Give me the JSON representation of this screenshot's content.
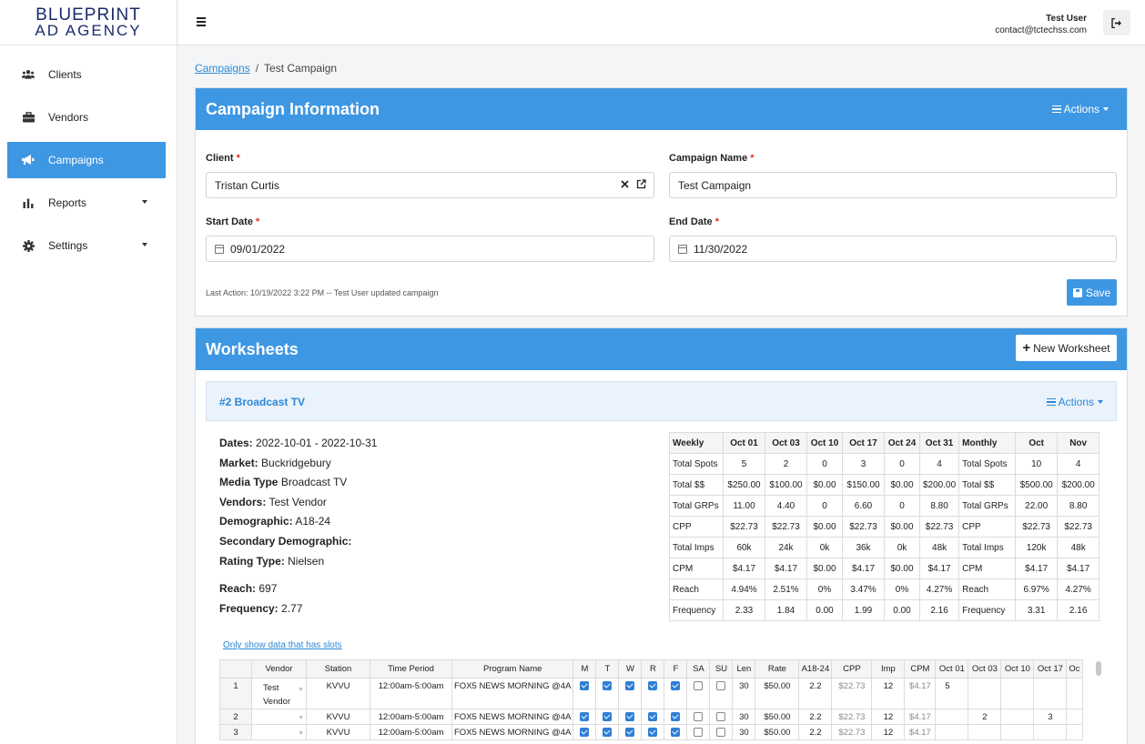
{
  "logo": {
    "line1": "BLUEPRINT",
    "line2": "AD AGENCY"
  },
  "sidebar": {
    "items": [
      {
        "label": "Clients",
        "icon": "users-icon"
      },
      {
        "label": "Vendors",
        "icon": "briefcase-icon"
      },
      {
        "label": "Campaigns",
        "icon": "megaphone-icon",
        "active": true
      },
      {
        "label": "Reports",
        "icon": "bar-chart-icon",
        "has_submenu": true
      },
      {
        "label": "Settings",
        "icon": "gear-icon",
        "has_submenu": true
      }
    ]
  },
  "topbar": {
    "user_name": "Test User",
    "user_email": "contact@tctechss.com"
  },
  "breadcrumb": {
    "parent": "Campaigns",
    "separator": "/",
    "current": "Test Campaign"
  },
  "campaign_info": {
    "title": "Campaign Information",
    "actions_label": "Actions",
    "client_label": "Client",
    "client_value": "Tristan Curtis",
    "campaign_name_label": "Campaign Name",
    "campaign_name_value": "Test Campaign",
    "start_date_label": "Start Date",
    "start_date_value": "09/01/2022",
    "end_date_label": "End Date",
    "end_date_value": "11/30/2022",
    "required_mark": "*",
    "last_action": "Last Action: 10/19/2022 3:22 PM -- Test User updated campaign",
    "save_label": "Save"
  },
  "worksheets": {
    "title": "Worksheets",
    "new_button_label": "New Worksheet",
    "worksheet": {
      "title": "#2 Broadcast TV",
      "actions_label": "Actions",
      "info": [
        {
          "label": "Dates:",
          "value": "2022-10-01 - 2022-10-31"
        },
        {
          "label": "Market:",
          "value": "Buckridgebury"
        },
        {
          "label": "Media Type",
          "value": "Broadcast TV"
        },
        {
          "label": "Vendors:",
          "value": "Test Vendor"
        },
        {
          "label": "Demographic:",
          "value": "A18-24"
        },
        {
          "label": "Secondary Demographic:",
          "value": ""
        },
        {
          "label": "Rating Type:",
          "value": "Nielsen"
        }
      ],
      "reach_label": "Reach:",
      "reach_value": "697",
      "frequency_label": "Frequency:",
      "frequency_value": "2.77",
      "summary": {
        "weekly_header": "Weekly",
        "weekly_cols": [
          "Oct 01",
          "Oct 03",
          "Oct 10",
          "Oct 17",
          "Oct 24",
          "Oct 31"
        ],
        "monthly_header": "Monthly",
        "monthly_cols": [
          "Oct",
          "Nov"
        ],
        "rows": [
          {
            "label": "Total Spots",
            "weekly": [
              "5",
              "2",
              "0",
              "3",
              "0",
              "4"
            ],
            "mlabel": "Total Spots",
            "monthly": [
              "10",
              "4"
            ]
          },
          {
            "label": "Total $$",
            "weekly": [
              "$250.00",
              "$100.00",
              "$0.00",
              "$150.00",
              "$0.00",
              "$200.00"
            ],
            "mlabel": "Total $$",
            "monthly": [
              "$500.00",
              "$200.00"
            ]
          },
          {
            "label": "Total GRPs",
            "weekly": [
              "11.00",
              "4.40",
              "0",
              "6.60",
              "0",
              "8.80"
            ],
            "mlabel": "Total GRPs",
            "monthly": [
              "22.00",
              "8.80"
            ]
          },
          {
            "label": "CPP",
            "weekly": [
              "$22.73",
              "$22.73",
              "$0.00",
              "$22.73",
              "$0.00",
              "$22.73"
            ],
            "mlabel": "CPP",
            "monthly": [
              "$22.73",
              "$22.73"
            ]
          },
          {
            "label": "Total Imps",
            "weekly": [
              "60k",
              "24k",
              "0k",
              "36k",
              "0k",
              "48k"
            ],
            "mlabel": "Total Imps",
            "monthly": [
              "120k",
              "48k"
            ]
          },
          {
            "label": "CPM",
            "weekly": [
              "$4.17",
              "$4.17",
              "$0.00",
              "$4.17",
              "$0.00",
              "$4.17"
            ],
            "mlabel": "CPM",
            "monthly": [
              "$4.17",
              "$4.17"
            ]
          },
          {
            "label": "Reach",
            "weekly": [
              "4.94%",
              "2.51%",
              "0%",
              "3.47%",
              "0%",
              "4.27%"
            ],
            "mlabel": "Reach",
            "monthly": [
              "6.97%",
              "4.27%"
            ]
          },
          {
            "label": "Frequency",
            "weekly": [
              "2.33",
              "1.84",
              "0.00",
              "1.99",
              "0.00",
              "2.16"
            ],
            "mlabel": "Frequency",
            "monthly": [
              "3.31",
              "2.16"
            ]
          }
        ]
      },
      "only_show_label": "Only show data that has slots",
      "grid": {
        "headers": [
          "",
          "Vendor",
          "Station",
          "Time Period",
          "Program Name",
          "M",
          "T",
          "W",
          "R",
          "F",
          "SA",
          "SU",
          "Len",
          "Rate",
          "A18-24",
          "CPP",
          "Imp",
          "CPM",
          "Oct 01",
          "Oct 03",
          "Oct 10",
          "Oct 17",
          "Oc"
        ],
        "rows": [
          {
            "no": "1",
            "vendor": "Test Vendor",
            "station": "KVVU",
            "time": "12:00am-5:00am",
            "program": "FOX5 NEWS MORNING @4A",
            "days": [
              true,
              true,
              true,
              true,
              true,
              false,
              false
            ],
            "len": "30",
            "rate": "$50.00",
            "demo": "2.2",
            "cpp": "$22.73",
            "imp": "12",
            "cpm": "$4.17",
            "weeks": [
              "5",
              "",
              "",
              "",
              ""
            ]
          },
          {
            "no": "2",
            "vendor": "",
            "station": "KVVU",
            "time": "12:00am-5:00am",
            "program": "FOX5 NEWS MORNING @4A",
            "days": [
              true,
              true,
              true,
              true,
              true,
              false,
              false
            ],
            "len": "30",
            "rate": "$50.00",
            "demo": "2.2",
            "cpp": "$22.73",
            "imp": "12",
            "cpm": "$4.17",
            "weeks": [
              "",
              "2",
              "",
              "3",
              ""
            ]
          },
          {
            "no": "3",
            "vendor": "",
            "station": "KVVU",
            "time": "12:00am-5:00am",
            "program": "FOX5 NEWS MORNING @4A",
            "days": [
              true,
              true,
              true,
              true,
              true,
              false,
              false
            ],
            "len": "30",
            "rate": "$50.00",
            "demo": "2.2",
            "cpp": "$22.73",
            "imp": "12",
            "cpm": "$4.17",
            "weeks": [
              "",
              "",
              "",
              "",
              ""
            ]
          }
        ]
      }
    }
  }
}
